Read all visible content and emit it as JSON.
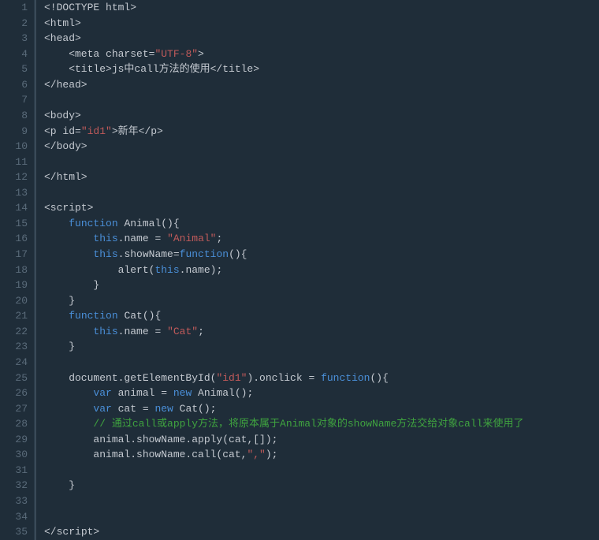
{
  "code": {
    "lines": [
      {
        "num": "1",
        "tokens": [
          {
            "cls": "txt",
            "t": "<!DOCTYPE html>"
          }
        ]
      },
      {
        "num": "2",
        "tokens": [
          {
            "cls": "txt",
            "t": "<html>"
          }
        ]
      },
      {
        "num": "3",
        "tokens": [
          {
            "cls": "txt",
            "t": "<head>"
          }
        ]
      },
      {
        "num": "4",
        "tokens": [
          {
            "cls": "txt",
            "t": "    <meta charset="
          },
          {
            "cls": "str",
            "t": "\"UTF-8\""
          },
          {
            "cls": "txt",
            "t": ">"
          }
        ]
      },
      {
        "num": "5",
        "tokens": [
          {
            "cls": "txt",
            "t": "    <title>js中call方法的使用</title>"
          }
        ]
      },
      {
        "num": "6",
        "tokens": [
          {
            "cls": "txt",
            "t": "</head>"
          }
        ]
      },
      {
        "num": "7",
        "tokens": []
      },
      {
        "num": "8",
        "tokens": [
          {
            "cls": "txt",
            "t": "<body>"
          }
        ]
      },
      {
        "num": "9",
        "tokens": [
          {
            "cls": "txt",
            "t": "<p id="
          },
          {
            "cls": "str",
            "t": "\"id1\""
          },
          {
            "cls": "txt",
            "t": ">新年</p>"
          }
        ]
      },
      {
        "num": "10",
        "tokens": [
          {
            "cls": "txt",
            "t": "</body>"
          }
        ]
      },
      {
        "num": "11",
        "tokens": []
      },
      {
        "num": "12",
        "tokens": [
          {
            "cls": "txt",
            "t": "</html>"
          }
        ]
      },
      {
        "num": "13",
        "tokens": []
      },
      {
        "num": "14",
        "tokens": [
          {
            "cls": "txt",
            "t": "<script>"
          }
        ]
      },
      {
        "num": "15",
        "tokens": [
          {
            "cls": "txt",
            "t": "    "
          },
          {
            "cls": "kw",
            "t": "function"
          },
          {
            "cls": "txt",
            "t": " Animal(){"
          }
        ]
      },
      {
        "num": "16",
        "tokens": [
          {
            "cls": "txt",
            "t": "        "
          },
          {
            "cls": "this",
            "t": "this"
          },
          {
            "cls": "txt",
            "t": ".name = "
          },
          {
            "cls": "str",
            "t": "\"Animal\""
          },
          {
            "cls": "txt",
            "t": ";"
          }
        ]
      },
      {
        "num": "17",
        "tokens": [
          {
            "cls": "txt",
            "t": "        "
          },
          {
            "cls": "this",
            "t": "this"
          },
          {
            "cls": "txt",
            "t": ".showName="
          },
          {
            "cls": "kw",
            "t": "function"
          },
          {
            "cls": "txt",
            "t": "(){"
          }
        ]
      },
      {
        "num": "18",
        "tokens": [
          {
            "cls": "txt",
            "t": "            alert("
          },
          {
            "cls": "this",
            "t": "this"
          },
          {
            "cls": "txt",
            "t": ".name);"
          }
        ]
      },
      {
        "num": "19",
        "tokens": [
          {
            "cls": "txt",
            "t": "        }"
          }
        ]
      },
      {
        "num": "20",
        "tokens": [
          {
            "cls": "txt",
            "t": "    }"
          }
        ]
      },
      {
        "num": "21",
        "tokens": [
          {
            "cls": "txt",
            "t": "    "
          },
          {
            "cls": "kw",
            "t": "function"
          },
          {
            "cls": "txt",
            "t": " Cat(){"
          }
        ]
      },
      {
        "num": "22",
        "tokens": [
          {
            "cls": "txt",
            "t": "        "
          },
          {
            "cls": "this",
            "t": "this"
          },
          {
            "cls": "txt",
            "t": ".name = "
          },
          {
            "cls": "str",
            "t": "\"Cat\""
          },
          {
            "cls": "txt",
            "t": ";"
          }
        ]
      },
      {
        "num": "23",
        "tokens": [
          {
            "cls": "txt",
            "t": "    }"
          }
        ]
      },
      {
        "num": "24",
        "tokens": []
      },
      {
        "num": "25",
        "tokens": [
          {
            "cls": "txt",
            "t": "    document.getElementById("
          },
          {
            "cls": "str",
            "t": "\"id1\""
          },
          {
            "cls": "txt",
            "t": ").onclick = "
          },
          {
            "cls": "kw",
            "t": "function"
          },
          {
            "cls": "txt",
            "t": "(){"
          }
        ]
      },
      {
        "num": "26",
        "tokens": [
          {
            "cls": "txt",
            "t": "        "
          },
          {
            "cls": "kw",
            "t": "var"
          },
          {
            "cls": "txt",
            "t": " animal = "
          },
          {
            "cls": "kw",
            "t": "new"
          },
          {
            "cls": "txt",
            "t": " Animal();"
          }
        ]
      },
      {
        "num": "27",
        "tokens": [
          {
            "cls": "txt",
            "t": "        "
          },
          {
            "cls": "kw",
            "t": "var"
          },
          {
            "cls": "txt",
            "t": " cat = "
          },
          {
            "cls": "kw",
            "t": "new"
          },
          {
            "cls": "txt",
            "t": " Cat();"
          }
        ]
      },
      {
        "num": "28",
        "tokens": [
          {
            "cls": "txt",
            "t": "        "
          },
          {
            "cls": "comment",
            "t": "// 通过call或apply方法，将原本属于Animal对象的showName方法交给对象call来使用了"
          }
        ]
      },
      {
        "num": "29",
        "tokens": [
          {
            "cls": "txt",
            "t": "        animal.showName.apply(cat,[]);"
          }
        ]
      },
      {
        "num": "30",
        "tokens": [
          {
            "cls": "txt",
            "t": "        animal.showName.call(cat,"
          },
          {
            "cls": "str",
            "t": "\",\""
          },
          {
            "cls": "txt",
            "t": ");"
          }
        ]
      },
      {
        "num": "31",
        "tokens": []
      },
      {
        "num": "32",
        "tokens": [
          {
            "cls": "txt",
            "t": "    }"
          }
        ]
      },
      {
        "num": "33",
        "tokens": []
      },
      {
        "num": "34",
        "tokens": []
      },
      {
        "num": "35",
        "tokens": [
          {
            "cls": "txt",
            "t": "</"
          },
          {
            "cls": "txt",
            "t": "script>"
          }
        ]
      }
    ]
  }
}
